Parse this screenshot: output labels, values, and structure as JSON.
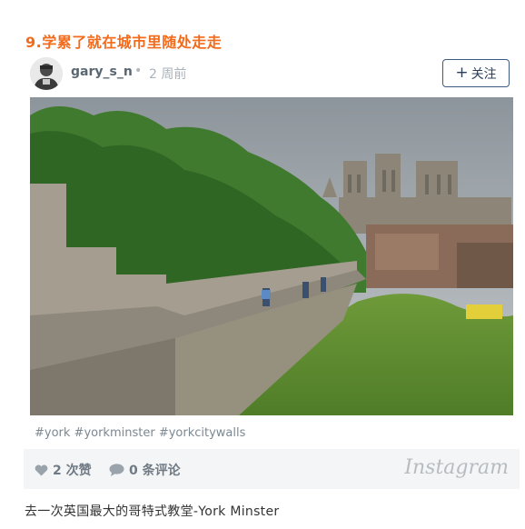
{
  "heading": "9.学累了就在城市里随处走走",
  "post": {
    "username": "gary_s_n",
    "dot": "•",
    "time": "2 周前",
    "follow_plus": "+",
    "follow_label": "关注",
    "tags": "#york #yorkminster #yorkcitywalls",
    "likes_label": "2 次赞",
    "comments_label": "0 条评论",
    "brand": "Instagram"
  },
  "caption": "去一次英国最大的哥特式教堂-York Minster",
  "colors": {
    "heading": "#f26b1d",
    "follow_border": "#3d5a80",
    "footer_bg": "#f4f5f6"
  }
}
